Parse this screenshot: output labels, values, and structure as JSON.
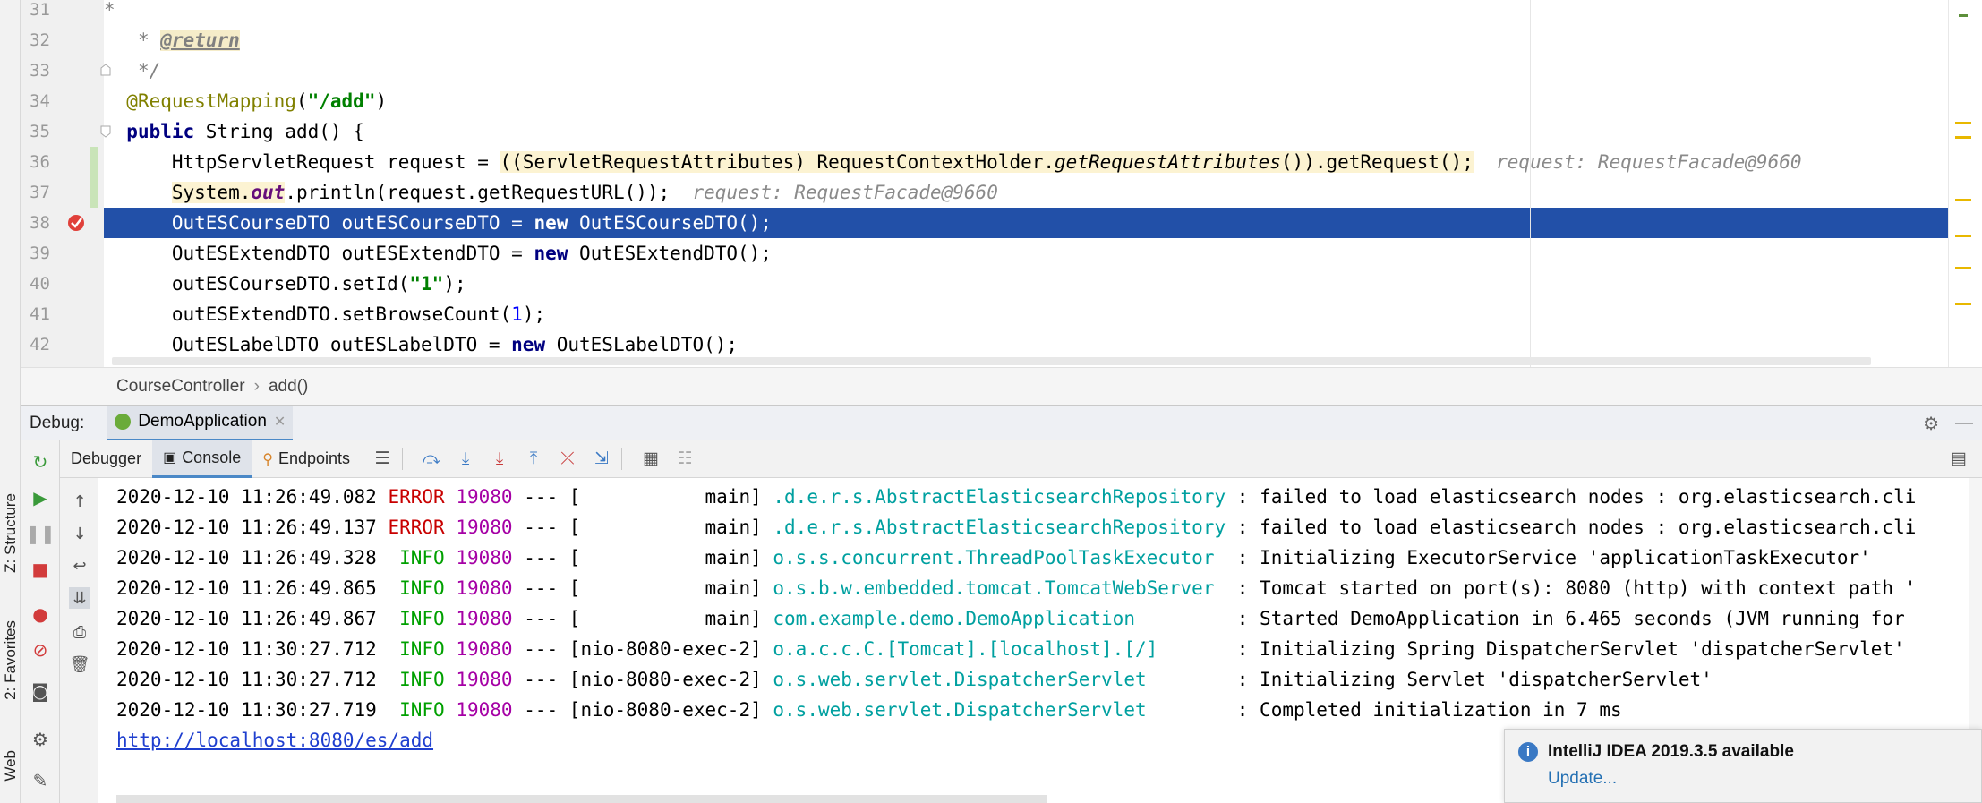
{
  "left_strip": {
    "tabs": [
      {
        "label": "Z: Structure"
      },
      {
        "label": "2: Favorites"
      },
      {
        "label": "Web"
      }
    ]
  },
  "editor": {
    "lines": [
      {
        "num": "31",
        "text": "   *"
      },
      {
        "num": "32",
        "text": "   * @return"
      },
      {
        "num": "33",
        "text": "   */"
      },
      {
        "num": "34",
        "text": "  @RequestMapping(\"/add\")"
      },
      {
        "num": "35",
        "text": "  public String add() {"
      },
      {
        "num": "36",
        "text": "      HttpServletRequest request = ((ServletRequestAttributes) RequestContextHolder.getRequestAttributes()).getRequest();"
      },
      {
        "num": "37",
        "text": "      System.out.println(request.getRequestURL());"
      },
      {
        "num": "38",
        "text": "      OutESCourseDTO outESCourseDTO = new OutESCourseDTO();"
      },
      {
        "num": "39",
        "text": "      OutESExtendDTO outESExtendDTO = new OutESExtendDTO();"
      },
      {
        "num": "40",
        "text": "      outESCourseDTO.setId(\"1\");"
      },
      {
        "num": "41",
        "text": "      outESExtendDTO.setBrowseCount(1);"
      },
      {
        "num": "42",
        "text": "      OutESLabelDTO outESLabelDTO = new OutESLabelDTO();"
      }
    ],
    "tokens": {
      "return_tag": "@return",
      "anno": "@RequestMapping",
      "add_path": "\"/add\"",
      "public_kw": "public",
      "string_type": " String add() {",
      "l36_a": "HttpServletRequest request = ",
      "l36_b": "((ServletRequestAttributes) RequestContextHolder.",
      "l36_c": "getRequestAttributes",
      "l36_d": "()).getRequest();",
      "l37_a": "System.",
      "l37_out": "out",
      "l37_b": ".println(request.getRequestURL());",
      "l38": "OutESCourseDTO outESCourseDTO = ",
      "l38_new": "new",
      "l38_b": " OutESCourseDTO();",
      "l39": "OutESExtendDTO outESExtendDTO = ",
      "l39_b": " OutESExtendDTO();",
      "l40_a": "outESCourseDTO.setId(",
      "l40_str": "\"1\"",
      "l40_b": ");",
      "l41_a": "outESExtendDTO.setBrowseCount(",
      "l41_num": "1",
      "l41_b": ");",
      "l42": "OutESLabelDTO outESLabelDTO = ",
      "l42_b": " OutESLabelDTO();",
      "star": "*",
      "star_tag_prefix": "* ",
      "end_comment": "*/"
    },
    "hints": {
      "line36": "request: RequestFacade@9660",
      "line37": "request: RequestFacade@9660"
    },
    "current_line": 38
  },
  "breadcrumb": {
    "items": [
      "CourseController",
      "add()"
    ],
    "separator": "›"
  },
  "debug": {
    "label": "Debug:",
    "session_tab": "DemoApplication",
    "tabs": [
      {
        "label": "Debugger"
      },
      {
        "label": "Console"
      },
      {
        "label": "Endpoints"
      }
    ]
  },
  "console": {
    "lines": [
      {
        "ts": "2020-12-10 11:26:49.082",
        "level": "ERROR",
        "pid": "19080",
        "sep": "---",
        "thread": "[           main]",
        "logger": ".d.e.r.s.AbstractElasticsearchRepository",
        "msg": ": failed to load elasticsearch nodes : org.elasticsearch.cli"
      },
      {
        "ts": "2020-12-10 11:26:49.137",
        "level": "ERROR",
        "pid": "19080",
        "sep": "---",
        "thread": "[           main]",
        "logger": ".d.e.r.s.AbstractElasticsearchRepository",
        "msg": ": failed to load elasticsearch nodes : org.elasticsearch.cli"
      },
      {
        "ts": "2020-12-10 11:26:49.328",
        "level": " INFO",
        "pid": "19080",
        "sep": "---",
        "thread": "[           main]",
        "logger": "o.s.s.concurrent.ThreadPoolTaskExecutor ",
        "msg": " : Initializing ExecutorService 'applicationTaskExecutor'"
      },
      {
        "ts": "2020-12-10 11:26:49.865",
        "level": " INFO",
        "pid": "19080",
        "sep": "---",
        "thread": "[           main]",
        "logger": "o.s.b.w.embedded.tomcat.TomcatWebServer ",
        "msg": " : Tomcat started on port(s): 8080 (http) with context path '"
      },
      {
        "ts": "2020-12-10 11:26:49.867",
        "level": " INFO",
        "pid": "19080",
        "sep": "---",
        "thread": "[           main]",
        "logger": "com.example.demo.DemoApplication        ",
        "msg": " : Started DemoApplication in 6.465 seconds (JVM running for"
      },
      {
        "ts": "2020-12-10 11:30:27.712",
        "level": " INFO",
        "pid": "19080",
        "sep": "---",
        "thread": "[nio-8080-exec-2]",
        "logger": "o.a.c.c.C.[Tomcat].[localhost].[/]      ",
        "msg": " : Initializing Spring DispatcherServlet 'dispatcherServlet'"
      },
      {
        "ts": "2020-12-10 11:30:27.712",
        "level": " INFO",
        "pid": "19080",
        "sep": "---",
        "thread": "[nio-8080-exec-2]",
        "logger": "o.s.web.servlet.DispatcherServlet       ",
        "msg": " : Initializing Servlet 'dispatcherServlet'"
      },
      {
        "ts": "2020-12-10 11:30:27.719",
        "level": " INFO",
        "pid": "19080",
        "sep": "---",
        "thread": "[nio-8080-exec-2]",
        "logger": "o.s.web.servlet.DispatcherServlet       ",
        "msg": " : Completed initialization in 7 ms"
      }
    ],
    "url": "http://localhost:8080/es/add"
  },
  "notification": {
    "title": "IntelliJ IDEA 2019.3.5 available",
    "link": "Update..."
  },
  "colors": {
    "selection": "#2250a8",
    "error": "#c80000",
    "info": "#00a000",
    "pid": "#a500a5",
    "logger": "#00a0a0",
    "link": "#1f3fcf"
  }
}
